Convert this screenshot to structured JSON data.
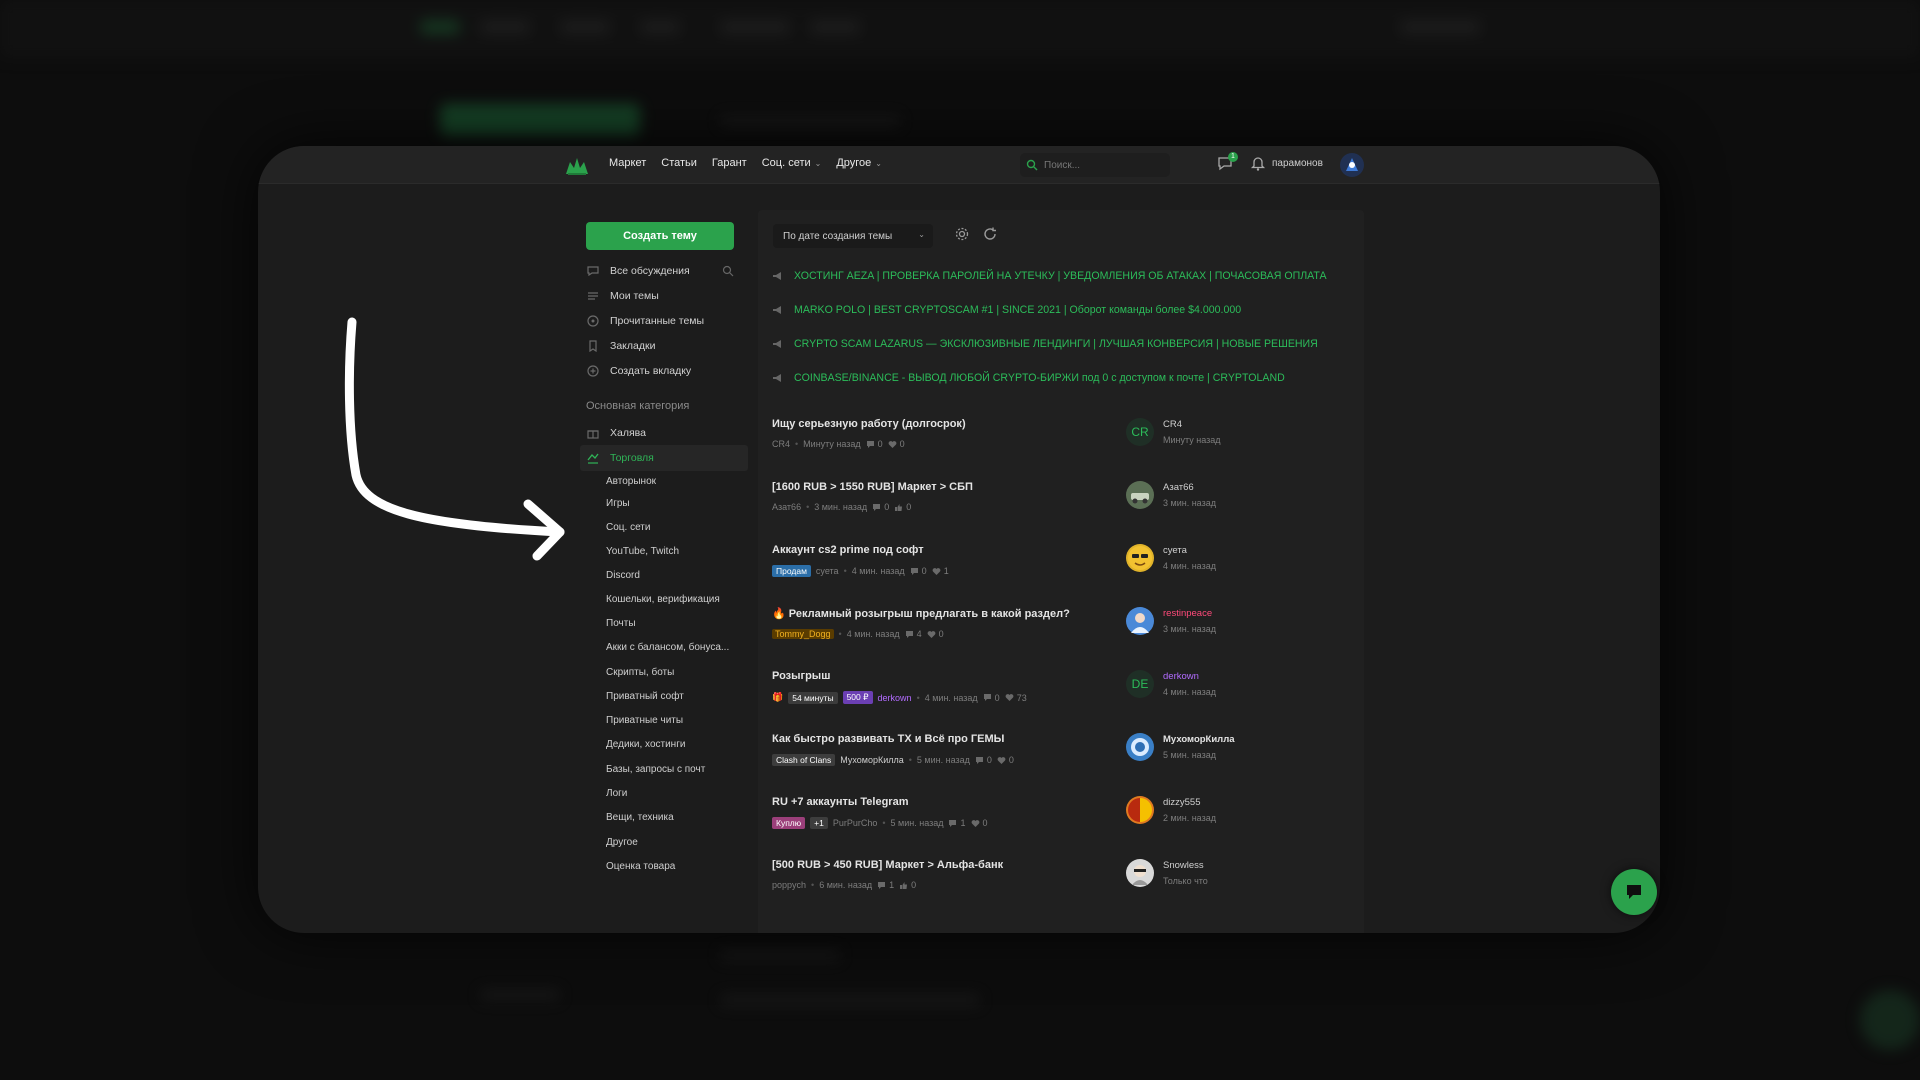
{
  "colors": {
    "accent": "#2ba24c",
    "announcement": "#2cbc5a",
    "background": "#1c1c1c",
    "panel": "#202020"
  },
  "topbar": {
    "logo_icon": "lolz-logo-icon",
    "nav": [
      {
        "label": "Маркет",
        "dropdown": false
      },
      {
        "label": "Статьи",
        "dropdown": false
      },
      {
        "label": "Гарант",
        "dropdown": false
      },
      {
        "label": "Соц. сети",
        "dropdown": true
      },
      {
        "label": "Другое",
        "dropdown": true
      }
    ],
    "search_placeholder": "Поиск...",
    "chat_badge": "1",
    "username": "парамонов"
  },
  "sidebar": {
    "create_button": "Создать тему",
    "items": [
      {
        "label": "Все обсуждения",
        "icon": "chat-bubble-icon"
      },
      {
        "label": "Мои темы",
        "icon": "list-icon"
      },
      {
        "label": "Прочитанные темы",
        "icon": "eye-icon"
      },
      {
        "label": "Закладки",
        "icon": "bookmark-icon"
      },
      {
        "label": "Создать вкладку",
        "icon": "plus-circle-icon"
      }
    ],
    "category_title": "Основная категория",
    "categories": [
      {
        "label": "Халява",
        "icon": "gift-icon",
        "active": false
      },
      {
        "label": "Торговля",
        "icon": "handshake-icon",
        "active": true
      }
    ],
    "subcategories": [
      "Авторынок",
      "Игры",
      "Соц. сети",
      "YouTube, Twitch",
      "Discord",
      "Кошельки, верификация",
      "Почты",
      "Акки с балансом, бонуса...",
      "Скрипты, боты",
      "Приватный софт",
      "Приватные читы",
      "Дедики, хостинги",
      "Базы, запросы с почт",
      "Логи",
      "Вещи, техника",
      "Другое",
      "Оценка товара"
    ]
  },
  "content": {
    "sort_label": "По дате создания темы",
    "announcements": [
      "ХОСТИНГ AEZA | ПРОВЕРКА ПАРОЛЕЙ НА УТЕЧКУ | УВЕДОМЛЕНИЯ ОБ АТАКАХ | ПОЧАСОВАЯ ОПЛАТА",
      "MARKO POLO | BEST CRYPTOSCAM #1 | SINCE 2021 | Оборот команды более $4.000.000",
      "CRYPTO SCAM LAZARUS — ЭКСКЛЮЗИВНЫЕ ЛЕНДИНГИ | ЛУЧШАЯ КОНВЕРСИЯ | НОВЫЕ РЕШЕНИЯ",
      "COINBASE/BINANCE - ВЫВОД ЛЮБОЙ CRYPTO-БИРЖИ под 0 с доступом к почте | CRYPTOLAND"
    ],
    "threads": [
      {
        "title": "Ищу серьезную работу (долгосрок)",
        "tags": [],
        "author": "CR4",
        "time": "Минуту назад",
        "replies": "0",
        "likes": "0",
        "last_user": "CR4",
        "last_time": "Минуту назад",
        "avatar_text": "CR",
        "avatar_color": "#1f2f26",
        "name_class": ""
      },
      {
        "title": "[1600 RUB > 1550 RUB] Маркет > СБП",
        "tags": [],
        "author": "Азат66",
        "time": "3 мин. назад",
        "replies": "0",
        "likes": "0",
        "last_user": "Азат66",
        "last_time": "3 мин. назад",
        "avatar_text": "",
        "avatar_color": "#5b6f55",
        "name_class": ""
      },
      {
        "title": "Аккаунт cs2 prime под софт",
        "tags": [
          {
            "label": "Продам",
            "color": "#2b6ea8"
          }
        ],
        "author": "суета",
        "time": "4 мин. назад",
        "replies": "0",
        "likes": "1",
        "last_user": "суета",
        "last_time": "4 мин. назад",
        "avatar_text": "😎",
        "avatar_color": "#e0b32a",
        "name_class": ""
      },
      {
        "title": "Рекламный розыгрыш предлагать в какой раздел?",
        "tags": [],
        "author": "Tommy_Dogg",
        "time": "4 мин. назад",
        "replies": "4",
        "likes": "0",
        "last_user": "restinpeace",
        "last_time": "3 мин. назад",
        "avatar_text": "",
        "avatar_color": "#4a89d8",
        "name_class": "pink"
      },
      {
        "title": "Розыгрыш",
        "tags": [
          {
            "label": "54 минуты",
            "color": "#3b3b3b"
          },
          {
            "label": "500 ₽",
            "color": "#6b3fb3"
          }
        ],
        "author": "derkown",
        "time": "4 мин. назад",
        "replies": "0",
        "likes": "73",
        "last_user": "derkown",
        "last_time": "4 мин. назад",
        "avatar_text": "DE",
        "avatar_color": "#1f2f26",
        "name_class": "purple"
      },
      {
        "title": "Как быстро развивать ТХ и Всё про ГЕМЫ",
        "tags": [
          {
            "label": "Clash of Clans",
            "color": "#3d3d3d"
          }
        ],
        "author": "МухоморКилла",
        "time": "5 мин. назад",
        "replies": "0",
        "likes": "0",
        "last_user": "МухоморКилла",
        "last_time": "5 мин. назад",
        "avatar_text": "",
        "avatar_color": "#3a7fc6",
        "name_class": ""
      },
      {
        "title": "RU +7 аккаунты Telegram",
        "tags": [
          {
            "label": "Куплю",
            "color": "#9b3f7a"
          },
          {
            "label": "+1",
            "color": "#3d3d3d"
          }
        ],
        "author": "PurPurCho",
        "time": "5 мин. назад",
        "replies": "1",
        "likes": "0",
        "last_user": "dizzy555",
        "last_time": "2 мин. назад",
        "avatar_text": "",
        "avatar_color": "#e07a20",
        "name_class": ""
      },
      {
        "title": "[500 RUB > 450 RUB] Маркет > Альфа-банк",
        "tags": [],
        "author": "poppych",
        "time": "6 мин. назад",
        "replies": "1",
        "likes": "0",
        "last_user": "Snowless",
        "last_time": "Только что",
        "avatar_text": "",
        "avatar_color": "#d9d9d9",
        "name_class": ""
      }
    ]
  }
}
